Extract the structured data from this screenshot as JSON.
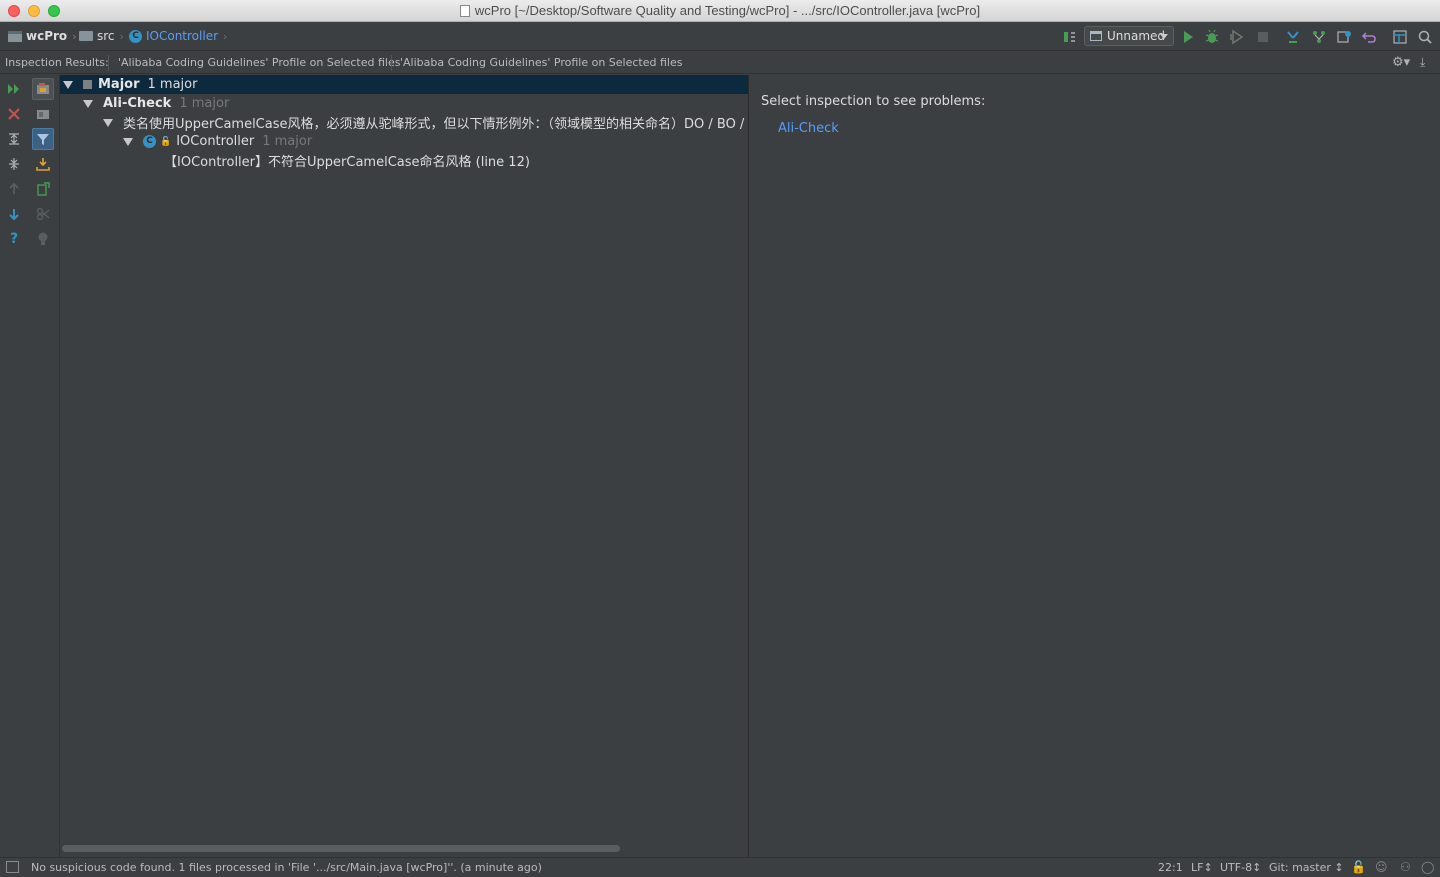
{
  "window": {
    "title": "wcPro [~/Desktop/Software Quality and Testing/wcPro] - .../src/IOController.java [wcPro]"
  },
  "navbar": {
    "breadcrumbs": [
      {
        "label": "wcPro",
        "icon": "project-folder-icon"
      },
      {
        "label": "src",
        "icon": "folder-icon"
      },
      {
        "label": "IOController",
        "icon": "class-icon"
      }
    ],
    "run_config": "Unnamed"
  },
  "inspection_header": {
    "label": "Inspection Results:",
    "tabs": [
      "'Alibaba Coding Guidelines' Profile on Selected files",
      "'Alibaba Coding Guidelines' Profile on Selected files"
    ]
  },
  "tree": {
    "rows": [
      {
        "title": "Major",
        "count": "1 major"
      },
      {
        "title": "Ali-Check",
        "count": "1 major"
      },
      {
        "title": "类名使用UpperCamelCase风格，必须遵从驼峰形式，但以下情形例外：（领域模型的相关命名）DO / BO / DTO / VO等"
      },
      {
        "title": "IOController",
        "count": "1 major",
        "class_letter": "C"
      },
      {
        "title": "【IOController】不符合UpperCamelCase命名风格 (line 12)"
      }
    ]
  },
  "details": {
    "title": "Select inspection to see problems:",
    "link": "Ali-Check"
  },
  "status": {
    "message": "No suspicious code found. 1 files processed in 'File '.../src/Main.java [wcPro]''. (a minute ago)",
    "position": "22:1",
    "line_sep": "LF↕",
    "encoding": "UTF-8↕",
    "vcs": "Git: master ↕"
  },
  "colors": {
    "background": "#3c3f41",
    "selection": "#0d293e",
    "link": "#589df6",
    "run_green": "#499c54",
    "error_red": "#c75450"
  }
}
